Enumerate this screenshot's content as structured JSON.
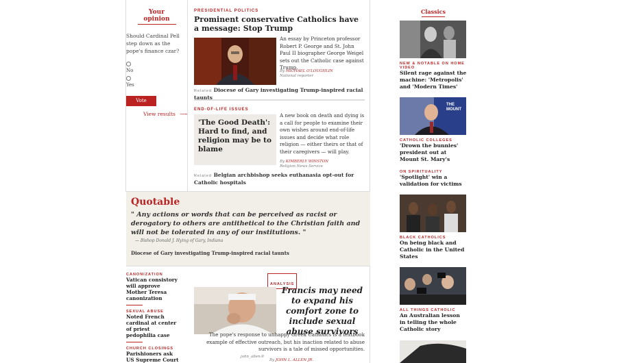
{
  "poll": {
    "title": "Your opinion",
    "question": "Should Cardinal Pell step down as the pope's finance czar?",
    "options": [
      "No",
      "Yes"
    ],
    "vote_label": "Vote",
    "results_label": "View results",
    "results_arrow": "⟶"
  },
  "story1": {
    "kicker": "Presidential Politics",
    "headline": "Prominent conservative Catholics have a message: Stop Trump",
    "body": "An essay by Princeton professor Robert P. George and St. John Paul II biographer George Weigel sets out the Catholic case against Trump.",
    "byline_prefix": "By",
    "author": "Michael O'Loughlin",
    "author_role": "National reporter",
    "related_label": "Related",
    "related": "Diocese of Gary investigating Trump-inspired racial taunts"
  },
  "story2": {
    "kicker": "End-of-life Issues",
    "headline": "'The Good Death': Hard to find, and religion may be to blame",
    "body": "A new book on death and dying is a call for people to examine their own wishes around end-of-life issues and decide what role religion — either theirs or that of their caregivers — will play.",
    "byline_prefix": "By",
    "author": "Kimberly Winston",
    "author_role": "Religion News Service",
    "related_label": "Related",
    "related": "Belgian archbishop seeks euthanasia opt-out for Catholic hospitals"
  },
  "quotable": {
    "title": "Quotable",
    "quote": "\" Any actions or words that can be perceived as racist or derogatory to others are antithetical to the Christian faith and will not be tolerated in any of our institutions. \"",
    "attribution": "— Bishop Donald J. Hying of Gary, Indiana",
    "link": "Diocese of Gary investigating Trump-inspired racial taunts"
  },
  "lower_left": [
    {
      "kicker": "Canonization",
      "title": "Vatican consistory will approve Mother Teresa canonization"
    },
    {
      "kicker": "Sexual Abuse",
      "title": "Noted French cardinal at center of priest pedophilia case"
    },
    {
      "kicker": "Church Closings",
      "title": "Parishioners ask US Supreme Court"
    }
  ],
  "analysis": {
    "badge": "Analysis",
    "headline": "Francis may need to expand his comfort zone to include sexual abuse survivors",
    "body": "The pope's response to unhappy Greek Catholics is a textbook example of effective outreach, but his inaction related to abuse survivors is a tale of missed opportunities.",
    "credit": "john_allen-9",
    "byline_prefix": "By",
    "author": "John L. Allen Jr."
  },
  "rail": {
    "title": "Classics",
    "items": [
      {
        "kicker": "New & Notable on Home Video",
        "title": "Silent rage against the machine: 'Metropolis' and 'Modern Times'"
      },
      {
        "kicker": "Catholic Colleges",
        "title": "'Drown the bunnies' president out at Mount St. Mary's"
      },
      {
        "kicker": "On Spirituality",
        "title": "'Spotlight' win a validation for victims"
      },
      {
        "kicker": "Black Catholics",
        "title": "On being black and Catholic in the United States"
      },
      {
        "kicker": "All Things Catholic",
        "title": "An Australian lesson in telling the whole Catholic story"
      }
    ],
    "sign_text": "THE MOUNT"
  },
  "colors": {
    "accent": "#bb2222",
    "quotable_bg": "#f2efe9"
  }
}
